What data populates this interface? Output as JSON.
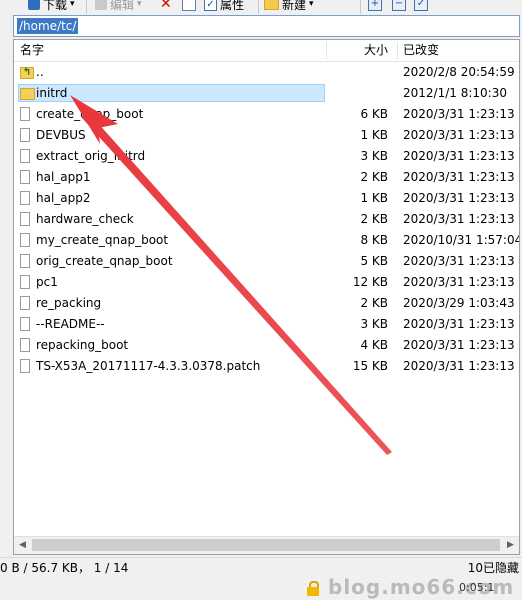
{
  "toolbar": {
    "download_label": "下载",
    "edit_label": "编辑",
    "properties_label": "属性",
    "new_label": "新建",
    "dropdown_glyph": "▾",
    "plus_glyph": "+",
    "minus_glyph": "−",
    "check_glyph": "✓"
  },
  "path": "/home/tc/",
  "columns": {
    "name": "名字",
    "size": "大小",
    "modified": "已改变"
  },
  "files": [
    {
      "name": "..",
      "size": "",
      "modified": "2020/2/8 20:54:59",
      "icon": "parent-folder-icon"
    },
    {
      "name": "initrd",
      "size": "",
      "modified": "2012/1/1 8:10:30",
      "icon": "folder-icon",
      "selected": true
    },
    {
      "name": "create_qnap_boot",
      "size": "6 KB",
      "modified": "2020/3/31 1:23:13",
      "icon": "file-icon"
    },
    {
      "name": "DEVBUS",
      "size": "1 KB",
      "modified": "2020/3/31 1:23:13",
      "icon": "file-icon"
    },
    {
      "name": "extract_orig_initrd",
      "size": "3 KB",
      "modified": "2020/3/31 1:23:13",
      "icon": "file-icon"
    },
    {
      "name": "hal_app1",
      "size": "2 KB",
      "modified": "2020/3/31 1:23:13",
      "icon": "file-icon"
    },
    {
      "name": "hal_app2",
      "size": "1 KB",
      "modified": "2020/3/31 1:23:13",
      "icon": "file-icon"
    },
    {
      "name": "hardware_check",
      "size": "2 KB",
      "modified": "2020/3/31 1:23:13",
      "icon": "file-icon"
    },
    {
      "name": "my_create_qnap_boot",
      "size": "8 KB",
      "modified": "2020/10/31 1:57:04",
      "icon": "file-icon"
    },
    {
      "name": "orig_create_qnap_boot",
      "size": "5 KB",
      "modified": "2020/3/31 1:23:13",
      "icon": "file-icon"
    },
    {
      "name": "pc1",
      "size": "12 KB",
      "modified": "2020/3/31 1:23:13",
      "icon": "file-icon"
    },
    {
      "name": "re_packing",
      "size": "2 KB",
      "modified": "2020/3/29 1:03:43",
      "icon": "file-icon"
    },
    {
      "name": "--README--",
      "size": "3 KB",
      "modified": "2020/3/31 1:23:13",
      "icon": "file-icon"
    },
    {
      "name": "repacking_boot",
      "size": "4 KB",
      "modified": "2020/3/31 1:23:13",
      "icon": "file-icon"
    },
    {
      "name": "TS-X53A_20171117-4.3.3.0378.patch",
      "size": "15 KB",
      "modified": "2020/3/31 1:23:13",
      "icon": "file-icon"
    }
  ],
  "status": {
    "left": "0 B / 56.7 KB，  1 / 14",
    "right": "10已隐藏"
  },
  "bottom": {
    "watermark": "blog.mo66.com",
    "time1": "0:05:1"
  },
  "colors": {
    "selection_bg": "#cce8ff",
    "arrow": "#e8383d",
    "path_highlight": "#3b79c4"
  }
}
